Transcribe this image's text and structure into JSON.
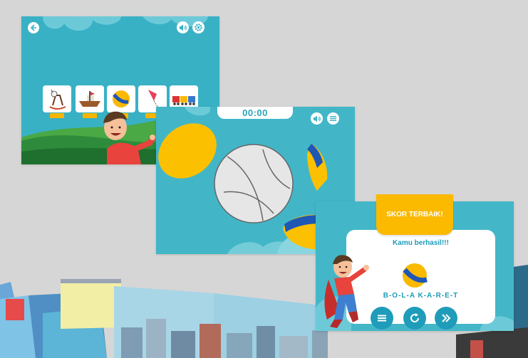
{
  "colors": {
    "sky": "#38b1c5",
    "accent_yellow": "#fbb900",
    "accent_blue": "#1f9cb9",
    "hill_green": "#2e8b3c",
    "ball_blue": "#1f57b5"
  },
  "screen1": {
    "back_icon": "arrow-left-icon",
    "sound_icon": "speaker-icon",
    "settings_icon": "gear-icon",
    "cards": [
      {
        "icon": "rocking-horse-icon"
      },
      {
        "icon": "ship-icon"
      },
      {
        "icon": "ball-icon"
      },
      {
        "icon": "kite-icon"
      },
      {
        "icon": "train-icon"
      }
    ]
  },
  "screen2": {
    "timer": "00:00",
    "sound_icon": "speaker-icon",
    "menu_icon": "menu-icon"
  },
  "screen3": {
    "best_score_label": "SKOR TERBAIK!",
    "success_message": "Kamu berhasil!!!",
    "word": "B-O-L-A  K-A-R-E-T",
    "buttons": [
      {
        "icon": "menu-icon"
      },
      {
        "icon": "replay-icon"
      },
      {
        "icon": "next-icon"
      }
    ]
  }
}
